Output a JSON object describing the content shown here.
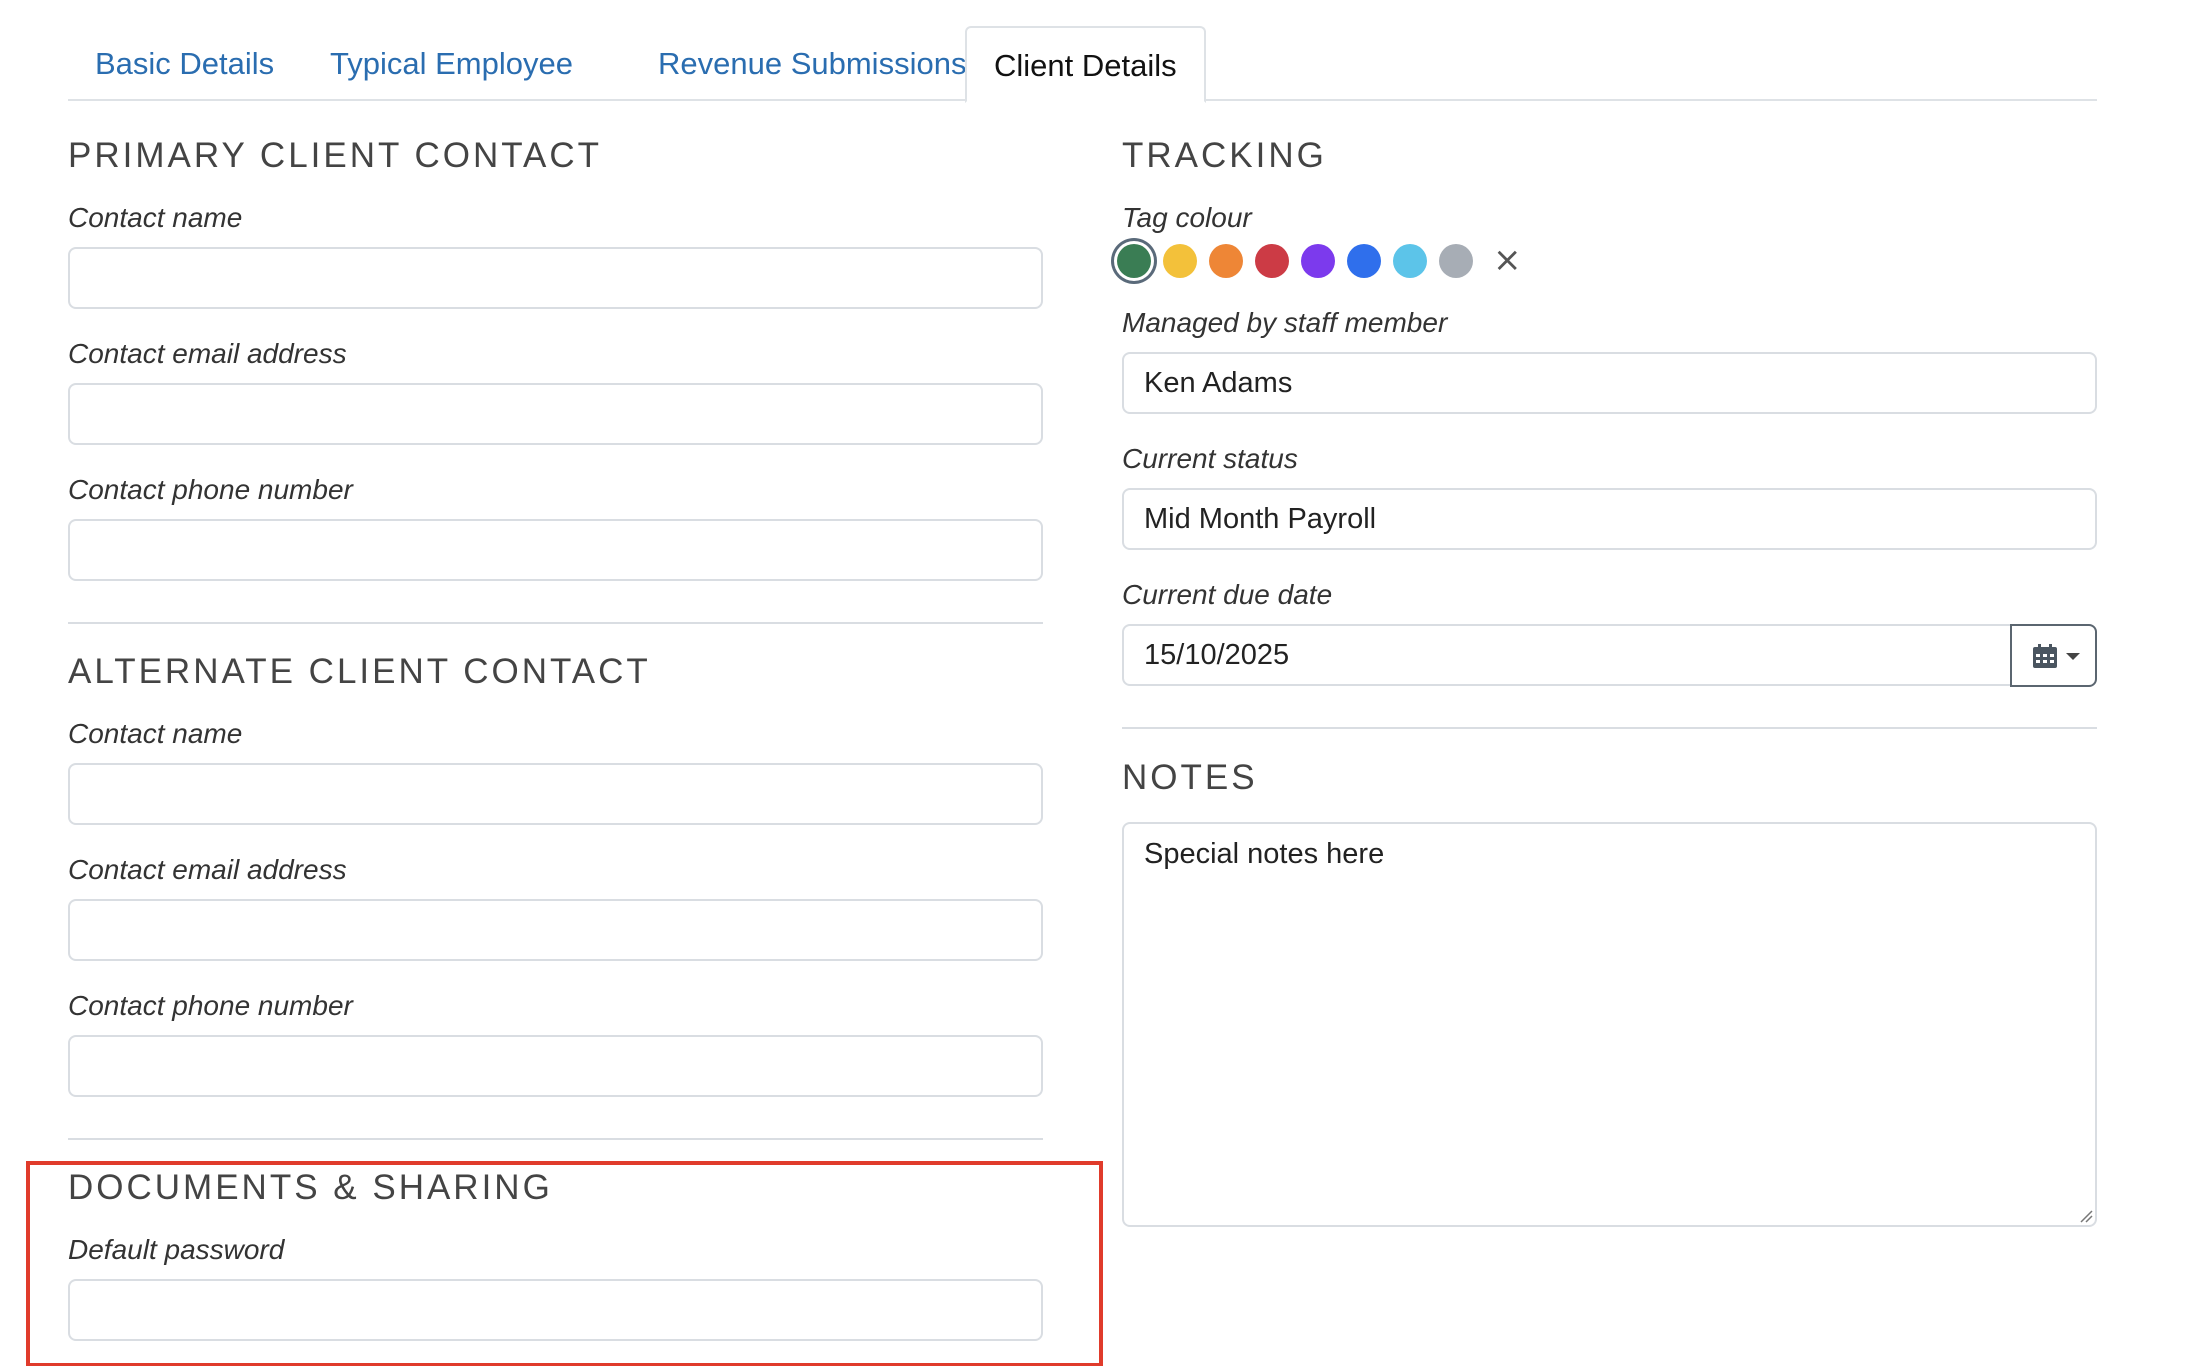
{
  "tabs": [
    {
      "label": "Basic Details",
      "active": false
    },
    {
      "label": "Typical Employee",
      "active": false
    },
    {
      "label": "Revenue Submissions",
      "active": false
    },
    {
      "label": "Client Details",
      "active": true
    }
  ],
  "primary_contact": {
    "title": "PRIMARY CLIENT CONTACT",
    "name_label": "Contact name",
    "name_value": "",
    "email_label": "Contact email address",
    "email_value": "",
    "phone_label": "Contact phone number",
    "phone_value": ""
  },
  "alternate_contact": {
    "title": "ALTERNATE CLIENT CONTACT",
    "name_label": "Contact name",
    "name_value": "",
    "email_label": "Contact email address",
    "email_value": "",
    "phone_label": "Contact phone number",
    "phone_value": ""
  },
  "documents": {
    "title": "DOCUMENTS & SHARING",
    "password_label": "Default password",
    "password_value": ""
  },
  "tracking": {
    "title": "TRACKING",
    "tag_colour_label": "Tag colour",
    "tag_colours": [
      "#3a7d54",
      "#f3c13a",
      "#ee8636",
      "#cc3b45",
      "#7c3aed",
      "#2f6fec",
      "#5cc4e9",
      "#a7adb5"
    ],
    "selected_colour": "#3a7d54",
    "clear_glyph": "×",
    "staff_label": "Managed by staff member",
    "staff_value": "Ken Adams",
    "status_label": "Current status",
    "status_value": "Mid Month Payroll",
    "due_label": "Current due date",
    "due_value": "15/10/2025"
  },
  "notes": {
    "title": "NOTES",
    "value": "Special notes here"
  },
  "icons": {
    "calendar": "calendar-icon",
    "caret": "chevron-down-icon"
  },
  "colors": {
    "link": "#2a6db0",
    "highlight": "#e03b2b"
  }
}
